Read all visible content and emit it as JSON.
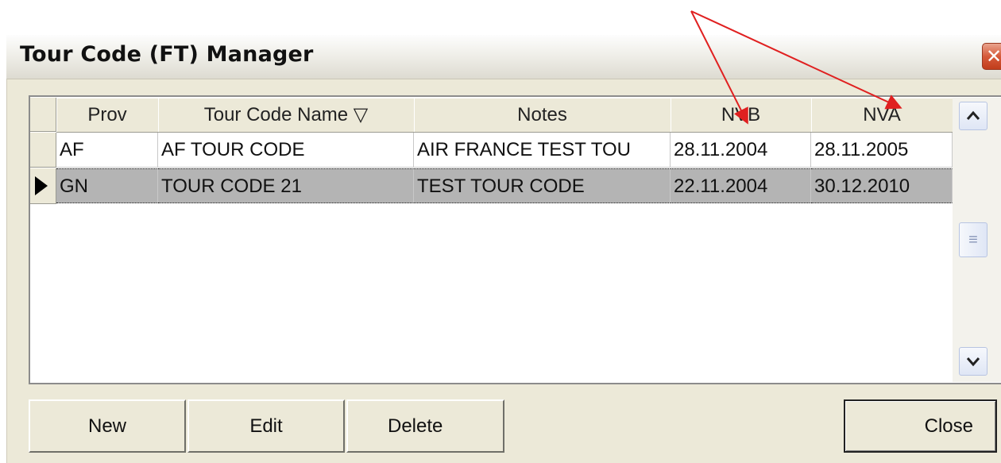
{
  "window": {
    "title": "Tour Code (FT) Manager",
    "close_glyph": "✕"
  },
  "grid": {
    "columns": [
      "Prov",
      "Tour Code Name ▽",
      "Notes",
      "NVB",
      "NVA"
    ],
    "rows": [
      {
        "prov": "AF",
        "name": "AF TOUR CODE",
        "notes": "AIR FRANCE TEST TOU",
        "nvb": "28.11.2004",
        "nva": "28.11.2005",
        "selected": false
      },
      {
        "prov": "GN",
        "name": "TOUR CODE 21",
        "notes": "TEST TOUR CODE",
        "nvb": "22.11.2004",
        "nva": "30.12.2010",
        "selected": true
      }
    ]
  },
  "scrollbar": {
    "up": "⌃",
    "thumb": "≡",
    "down": "⌄"
  },
  "buttons": {
    "new": "New",
    "edit": "Edit",
    "delete": "Delete",
    "close": "Close"
  },
  "colors": {
    "selection": "#b4b4b4",
    "annotation_arrow": "#e02020"
  }
}
